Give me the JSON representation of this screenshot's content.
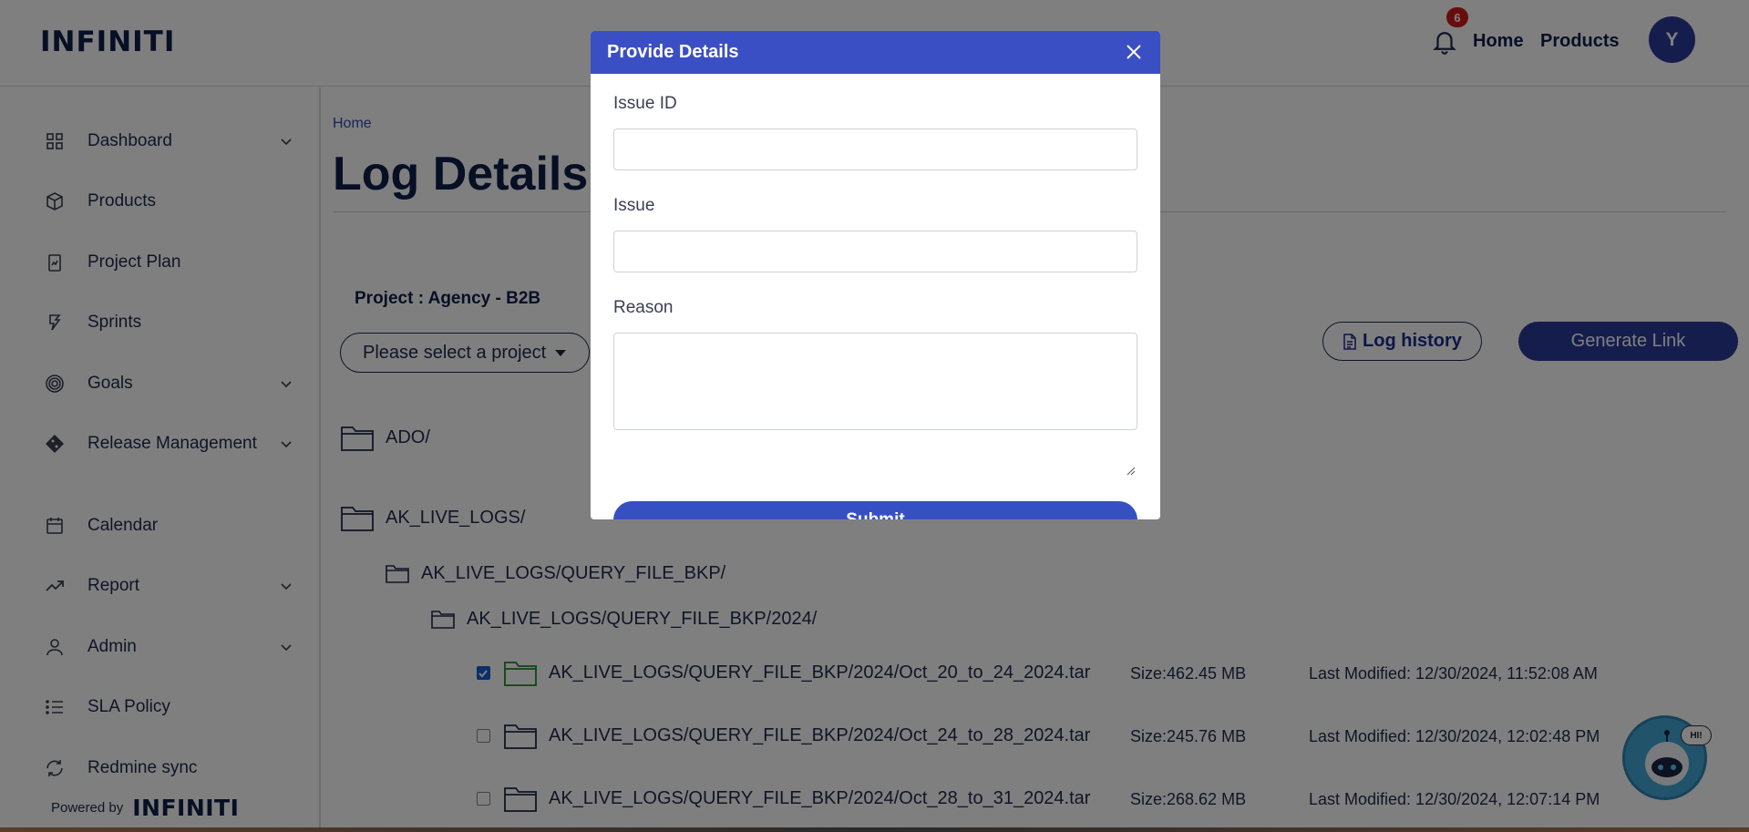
{
  "header": {
    "logo": "INFINITI",
    "notification_count": "6",
    "nav": [
      "Home",
      "Products"
    ],
    "avatar_initial": "Y"
  },
  "sidebar": {
    "items": [
      {
        "label": "Dashboard",
        "icon": "grid-icon",
        "has_chevron": true
      },
      {
        "label": "Products",
        "icon": "box-icon",
        "has_chevron": false
      },
      {
        "label": "Project Plan",
        "icon": "clipboard-icon",
        "has_chevron": false
      },
      {
        "label": "Sprints",
        "icon": "sprint-icon",
        "has_chevron": false
      },
      {
        "label": "Goals",
        "icon": "target-icon",
        "has_chevron": true
      },
      {
        "label": "Release Management",
        "icon": "git-icon",
        "has_chevron": true
      },
      {
        "label": "Calendar",
        "icon": "calendar-icon",
        "has_chevron": false
      },
      {
        "label": "Report",
        "icon": "trend-icon",
        "has_chevron": true
      },
      {
        "label": "Admin",
        "icon": "user-icon",
        "has_chevron": true
      },
      {
        "label": "SLA Policy",
        "icon": "list-icon",
        "has_chevron": false
      },
      {
        "label": "Redmine sync",
        "icon": "sync-icon",
        "has_chevron": false
      }
    ],
    "powered_by": "Powered by",
    "powered_logo": "INFINITI"
  },
  "main": {
    "breadcrumb": "Home",
    "title": "Log Details",
    "project_label": "Project : Agency - B2B",
    "project_select": "Please select a project",
    "log_history": "Log history",
    "generate_link": "Generate Link",
    "folders": [
      {
        "label": "ADO/"
      },
      {
        "label": "AK_LIVE_LOGS/"
      },
      {
        "label": "AK_LIVE_LOGS/QUERY_FILE_BKP/"
      },
      {
        "label": "AK_LIVE_LOGS/QUERY_FILE_BKP/2024/"
      }
    ],
    "files": [
      {
        "label": "AK_LIVE_LOGS/QUERY_FILE_BKP/2024/Oct_20_to_24_2024.tar",
        "size": "Size:462.45 MB",
        "modified": "Last Modified: 12/30/2024, 11:52:08 AM",
        "checked": true
      },
      {
        "label": "AK_LIVE_LOGS/QUERY_FILE_BKP/2024/Oct_24_to_28_2024.tar",
        "size": "Size:245.76 MB",
        "modified": "Last Modified: 12/30/2024, 12:02:48 PM",
        "checked": false
      },
      {
        "label": "AK_LIVE_LOGS/QUERY_FILE_BKP/2024/Oct_28_to_31_2024.tar",
        "size": "Size:268.62 MB",
        "modified": "Last Modified: 12/30/2024, 12:07:14 PM",
        "checked": false
      }
    ]
  },
  "chatbot": {
    "bubble": "HI!"
  },
  "modal": {
    "title": "Provide Details",
    "fields": [
      {
        "label": "Issue ID",
        "value": ""
      },
      {
        "label": "Issue",
        "value": ""
      },
      {
        "label": "Reason",
        "value": ""
      }
    ],
    "submit": "Submit"
  },
  "colors": {
    "brand_navy": "#0f1e4a",
    "accent_blue": "#3b4fc4",
    "badge_red": "#d11a1a",
    "checked_folder": "#1e8a2e"
  }
}
